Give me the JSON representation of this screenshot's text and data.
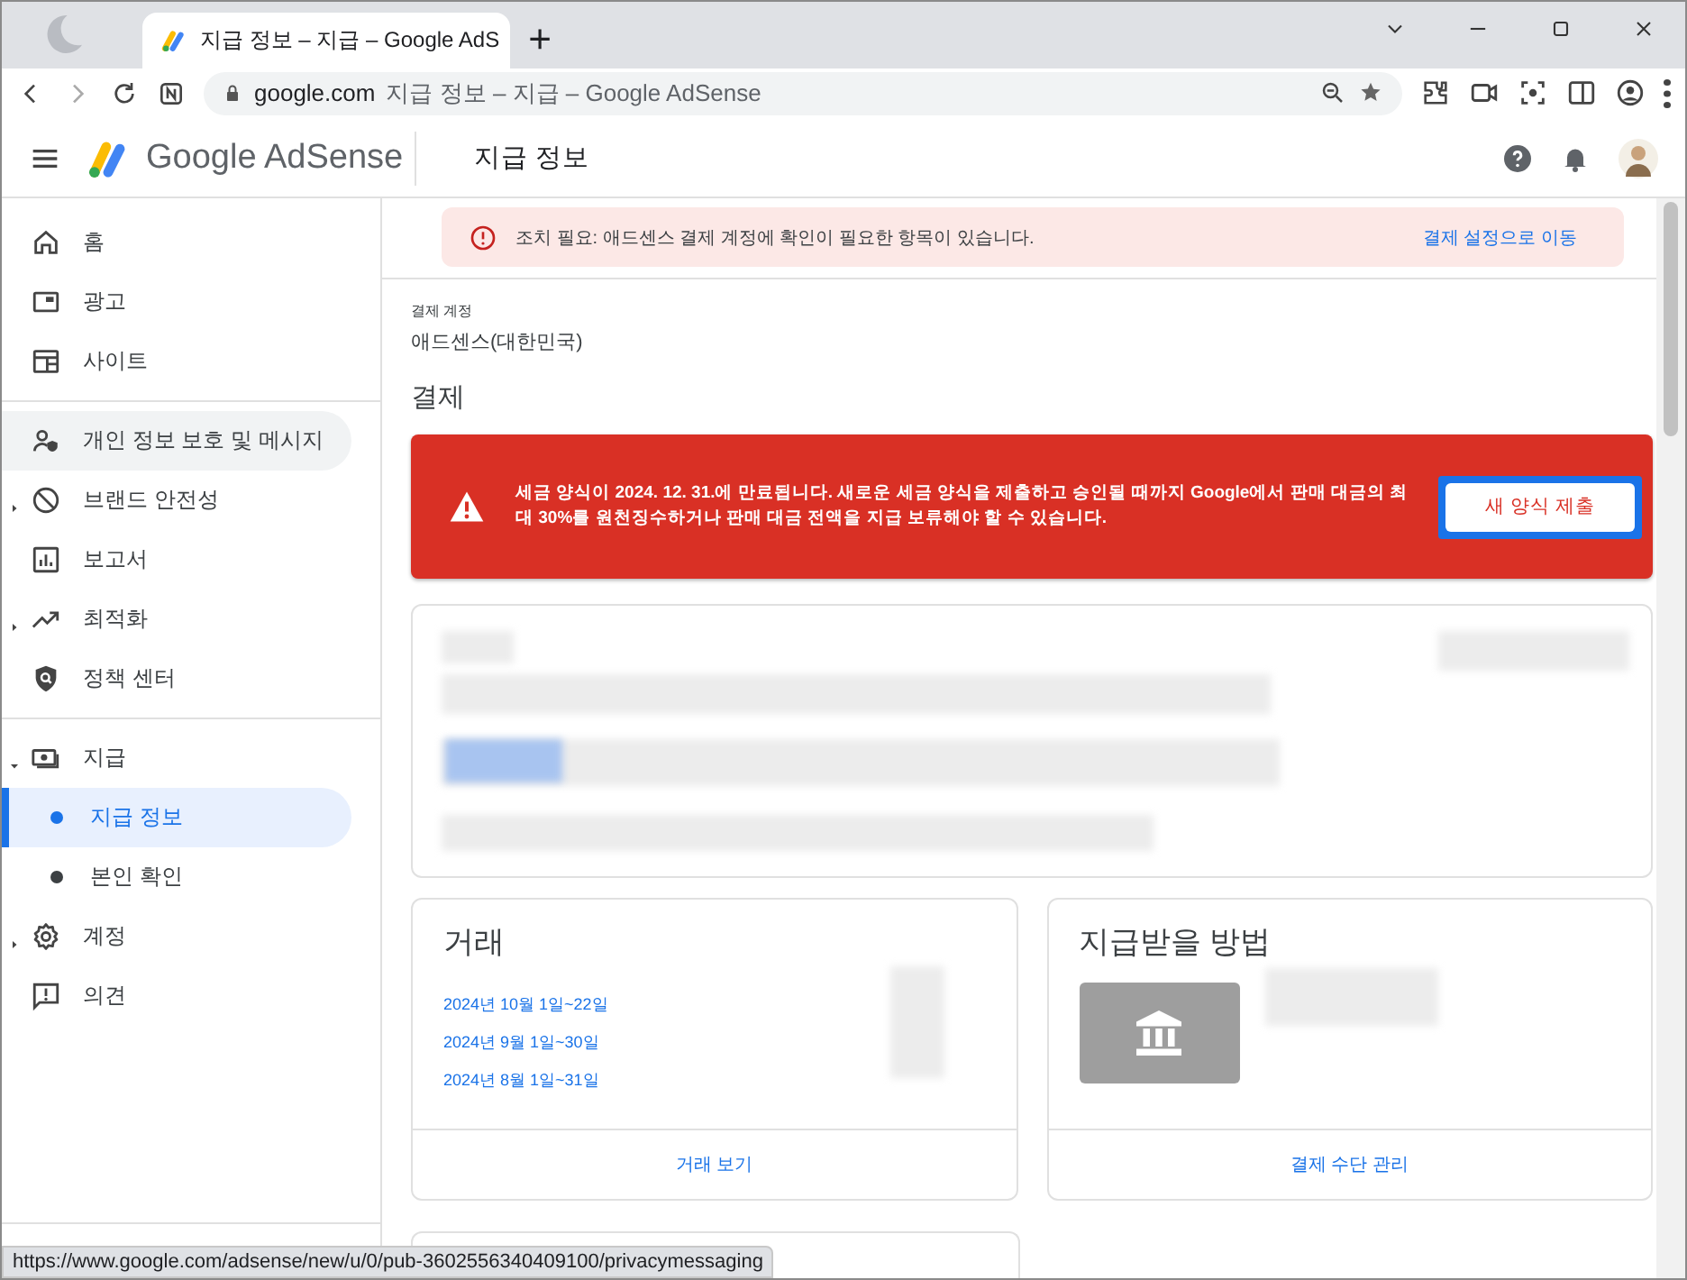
{
  "browser": {
    "tab_title": "지급 정보 – 지급 – Google AdS",
    "new_tab": "+",
    "address_domain": "google.com",
    "address_title": "지급 정보 – 지급 – Google AdSense"
  },
  "header": {
    "product": "Google AdSense",
    "page_title": "지급 정보"
  },
  "sidebar": {
    "items": [
      {
        "label": "홈",
        "selected": false,
        "hovered": false
      },
      {
        "label": "광고",
        "selected": false,
        "hovered": false
      },
      {
        "label": "사이트",
        "selected": false,
        "hovered": false,
        "divider_after": true
      },
      {
        "label": "개인 정보 보호 및 메시지",
        "selected": false,
        "hovered": true
      },
      {
        "label": "브랜드 안전성",
        "selected": false,
        "hovered": false,
        "expanded": false
      },
      {
        "label": "보고서",
        "selected": false,
        "hovered": false
      },
      {
        "label": "최적화",
        "selected": false,
        "hovered": false,
        "expanded": false
      },
      {
        "label": "정책 센터",
        "selected": false,
        "hovered": false,
        "divider_after": true
      },
      {
        "label": "지급",
        "selected": false,
        "hovered": false,
        "expanded": true,
        "children": [
          {
            "label": "지급 정보",
            "selected": true
          },
          {
            "label": "본인 확인",
            "selected": false
          }
        ]
      },
      {
        "label": "계정",
        "selected": false,
        "hovered": false,
        "expanded": false
      },
      {
        "label": "의견",
        "selected": false,
        "hovered": false
      }
    ]
  },
  "notice": {
    "text": "조치 필요: 애드센스 결제 계정에 확인이 필요한 항목이 있습니다.",
    "link": "결제 설정으로 이동"
  },
  "account": {
    "label": "결제 계정",
    "value": "애드센스(대한민국)"
  },
  "section_title": "결제",
  "tax_alert": {
    "text": "세금 양식이 2024. 12. 31.에 만료됩니다. 새로운 세금 양식을 제출하고 승인될 때까지 Google에서 판매 대금의 최대 30%를 원천징수하거나 판매 대금 전액을 지급 보류해야 할 수 있습니다.",
    "button": "새 양식 제출",
    "button_focused": true
  },
  "transactions": {
    "title": "거래",
    "rows": [
      "2024년 10월 1일~22일",
      "2024년 9월 1일~30일",
      "2024년 8월 1일~31일"
    ],
    "link": "거래 보기"
  },
  "payment_method": {
    "title": "지급받을 방법",
    "link": "결제 수단 관리"
  },
  "status_url": "https://www.google.com/adsense/new/u/0/pub-3602556340409100/privacymessaging"
}
